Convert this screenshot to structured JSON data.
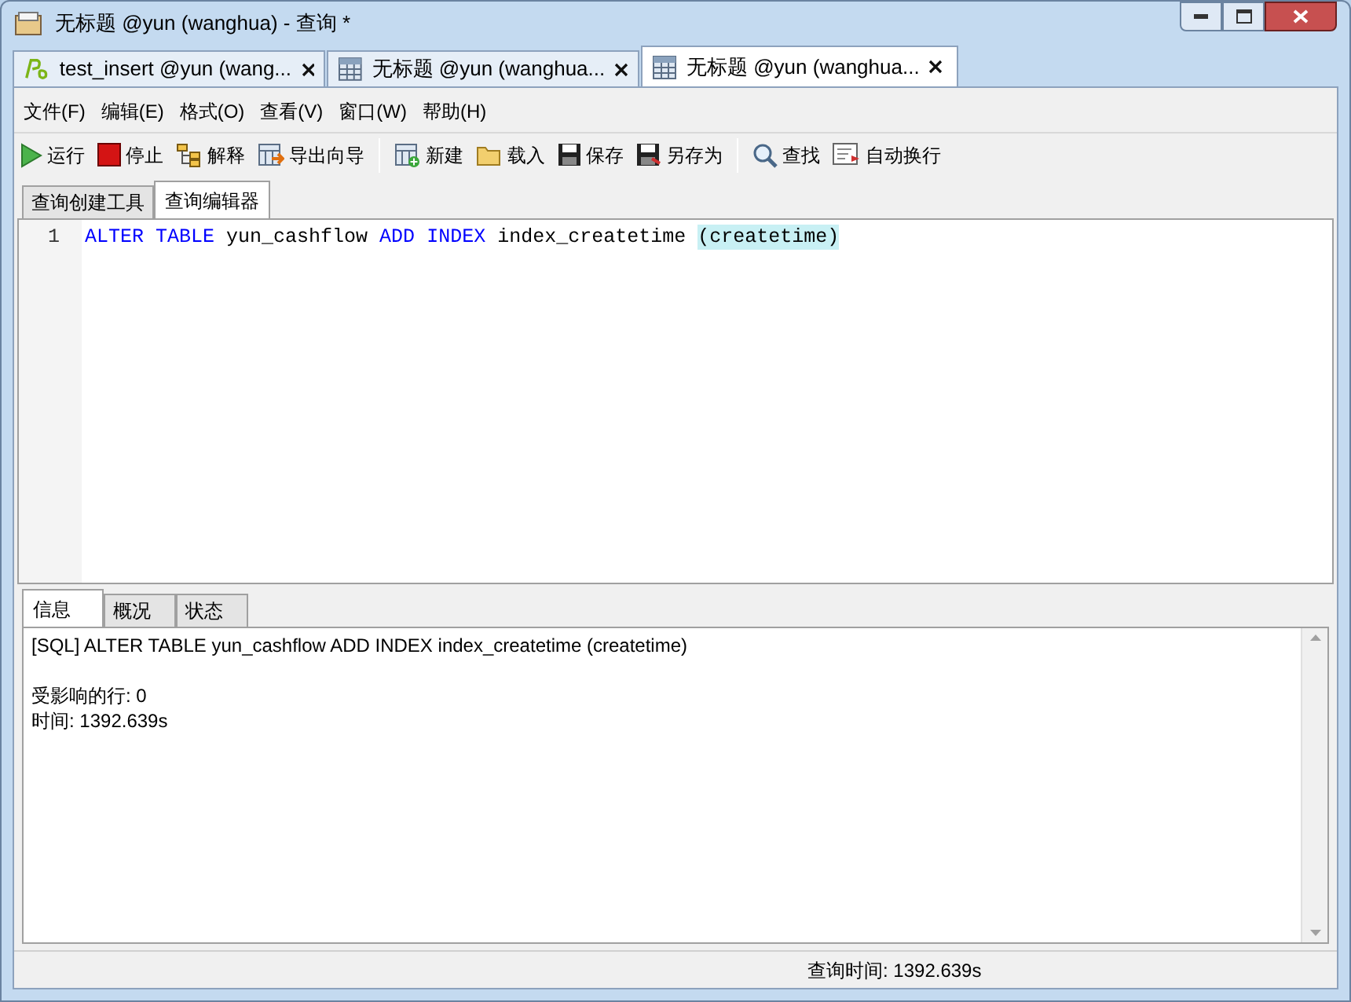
{
  "window": {
    "title": "无标题 @yun (wanghua) - 查询 *"
  },
  "doc_tabs": [
    {
      "label": "test_insert @yun (wang...",
      "selected": false
    },
    {
      "label": "无标题 @yun (wanghua...",
      "selected": false
    },
    {
      "label": "无标题 @yun (wanghua...",
      "selected": true
    }
  ],
  "menu": [
    "文件(F)",
    "编辑(E)",
    "格式(O)",
    "查看(V)",
    "窗口(W)",
    "帮助(H)"
  ],
  "toolbar": [
    {
      "kind": "button",
      "label": "运行"
    },
    {
      "kind": "button",
      "label": "停止"
    },
    {
      "kind": "button",
      "label": "解释"
    },
    {
      "kind": "button",
      "label": "导出向导"
    },
    {
      "kind": "separator"
    },
    {
      "kind": "button",
      "label": "新建"
    },
    {
      "kind": "button",
      "label": "载入"
    },
    {
      "kind": "button",
      "label": "保存"
    },
    {
      "kind": "button",
      "label": "另存为"
    },
    {
      "kind": "separator"
    },
    {
      "kind": "button",
      "label": "查找"
    },
    {
      "kind": "button",
      "label": "自动换行"
    }
  ],
  "editor_tabs": [
    {
      "label": "查询创建工具",
      "selected": false
    },
    {
      "label": "查询编辑器",
      "selected": true
    }
  ],
  "editor": {
    "lines": [
      {
        "number": "1",
        "tokens": [
          {
            "text": "ALTER",
            "kind": "keyword"
          },
          {
            "text": "TABLE",
            "kind": "keyword"
          },
          {
            "text": "yun_cashflow",
            "kind": "plain"
          },
          {
            "text": "ADD",
            "kind": "keyword"
          },
          {
            "text": "INDEX",
            "kind": "keyword"
          },
          {
            "text": "index_createtime",
            "kind": "plain"
          },
          {
            "text": "(createtime)",
            "kind": "bracket-match"
          }
        ]
      }
    ]
  },
  "result_tabs": [
    {
      "label": "信息",
      "selected": true
    },
    {
      "label": "概况",
      "selected": false
    },
    {
      "label": "状态",
      "selected": false
    }
  ],
  "messages": [
    "[SQL] ALTER TABLE yun_cashflow ADD INDEX index_createtime (createtime)",
    "受影响的行: 0",
    "时间: 1392.639s"
  ],
  "status_bar": {
    "query_time": "查询时间: 1392.639s"
  }
}
